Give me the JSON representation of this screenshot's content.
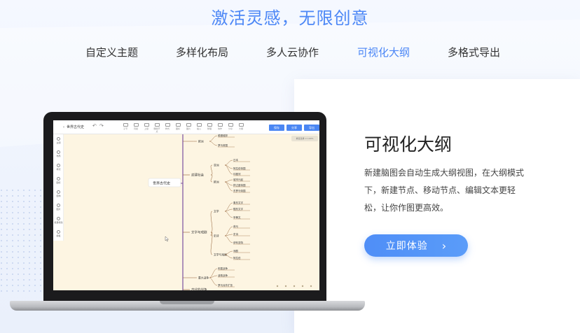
{
  "headline": "激活灵感，无限创意",
  "tabs": [
    {
      "label": "自定义主题",
      "active": false
    },
    {
      "label": "多样化布局",
      "active": false
    },
    {
      "label": "多人云协作",
      "active": false
    },
    {
      "label": "可视化大纲",
      "active": true
    },
    {
      "label": "多格式导出",
      "active": false
    }
  ],
  "feature": {
    "title": "可视化大纲",
    "description": "新建脑图会自动生成大纲视图，在大纲模式下，新建节点、移动节点、编辑文本更轻松，让你作图更高效。",
    "cta_label": "立即体验",
    "cta_icon": "chevron-right-icon"
  },
  "colors": {
    "accent": "#4c87f6",
    "canvas": "#fdf5e2",
    "branch": "#8e5a2e",
    "root_branch": "#7b4fa0"
  },
  "app": {
    "doc_title": "世界古代史",
    "toolbar_items": [
      "子节",
      "同级",
      "上级",
      "删除节点",
      "样式",
      "图标",
      "图片",
      "插入",
      "整理",
      "协作",
      "分享",
      "大纲"
    ],
    "buttons": [
      "保存",
      "分享",
      "导出"
    ],
    "side_items": [
      "主题",
      "布局",
      "样式",
      "图标",
      "结构",
      "图片",
      "批量修改",
      "模板"
    ],
    "badge": "重置选择 ⊙ 100%"
  },
  "mindmap": {
    "root": "世界古代史",
    "branches": [
      {
        "label": "",
        "children": [
          {
            "label": "欧洲",
            "leaves": [
              "希腊城邦",
              "罗马帝国"
            ]
          }
        ]
      },
      {
        "label": "封建社会",
        "children": [
          {
            "label": "亚洲",
            "leaves": [
              "日本",
              "阿拉伯帝国",
              "印度河"
            ]
          },
          {
            "label": "欧洲",
            "leaves": [
              "城市兴起",
              "拜占庭帝国",
              "东罗马帝国"
            ]
          }
        ]
      },
      {
        "label": "文学与戏剧",
        "children": [
          {
            "label": "文学",
            "leaves": [
              "象形文字",
              "楔形文字",
              "甲骨文"
            ]
          },
          {
            "label": "史诗",
            "leaves": [
              "荷马",
              "史诗",
              "伊利亚特"
            ]
          },
          {
            "label": "文学与戏剧",
            "leaves": [
              "戏剧",
              "阿拉伯"
            ]
          }
        ]
      },
      {
        "label": "",
        "children": [
          {
            "label": "重大战争",
            "leaves": [
              "布匿战争",
              "波希战争",
              "罗马对外扩张"
            ]
          }
        ]
      },
      {
        "label": "古代的战争",
        "children": []
      }
    ]
  }
}
